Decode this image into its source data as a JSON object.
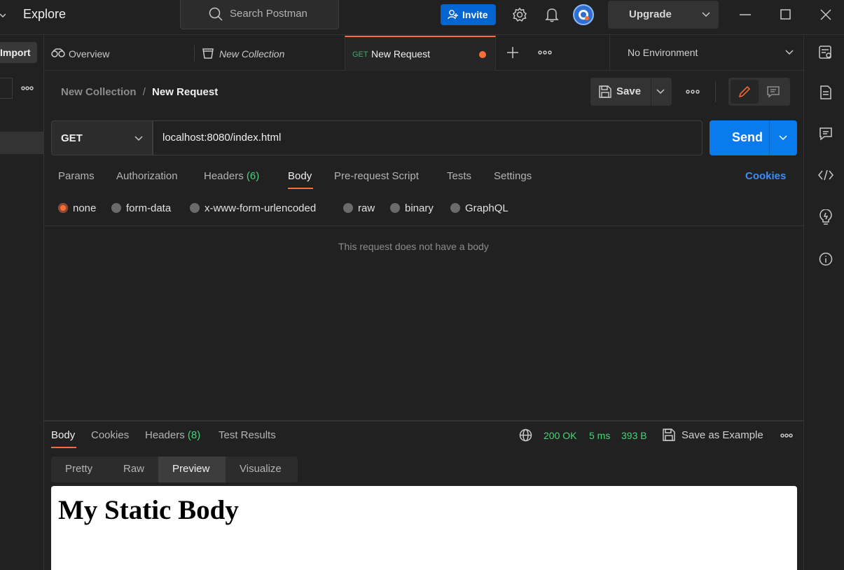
{
  "topbar": {
    "section_title": "Explore",
    "search_placeholder": "Search Postman",
    "invite_label": "Invite",
    "upgrade_label": "Upgrade"
  },
  "sidebar": {
    "import_label": "Import"
  },
  "tabs": [
    {
      "label": "Overview"
    },
    {
      "label": "New Collection"
    },
    {
      "method": "GET",
      "label": "New Request",
      "unsaved": true
    }
  ],
  "environment": {
    "selected": "No Environment"
  },
  "breadcrumb": {
    "collection": "New Collection",
    "separator": "/",
    "request": "New Request"
  },
  "save_label": "Save",
  "request": {
    "method": "GET",
    "url": "localhost:8080/index.html",
    "send_label": "Send",
    "tabs": [
      {
        "label": "Params"
      },
      {
        "label": "Authorization"
      },
      {
        "label": "Headers",
        "count": "(6)"
      },
      {
        "label": "Body"
      },
      {
        "label": "Pre-request Script"
      },
      {
        "label": "Tests"
      },
      {
        "label": "Settings"
      }
    ],
    "cookies_label": "Cookies",
    "body_types": [
      "none",
      "form-data",
      "x-www-form-urlencoded",
      "raw",
      "binary",
      "GraphQL"
    ],
    "selected_body_type": "none",
    "no_body_message": "This request does not have a body"
  },
  "response": {
    "tabs": [
      {
        "label": "Body"
      },
      {
        "label": "Cookies"
      },
      {
        "label": "Headers",
        "count": "(8)"
      },
      {
        "label": "Test Results"
      }
    ],
    "status": "200 OK",
    "time": "5 ms",
    "size": "393 B",
    "save_example_label": "Save as Example",
    "view_tabs": [
      "Pretty",
      "Raw",
      "Preview",
      "Visualize"
    ],
    "selected_view": "Preview",
    "preview_heading": "My Static Body"
  },
  "colors": {
    "accent": "#ff6c37",
    "primary": "#097bed",
    "status_ok": "#49d37a"
  }
}
